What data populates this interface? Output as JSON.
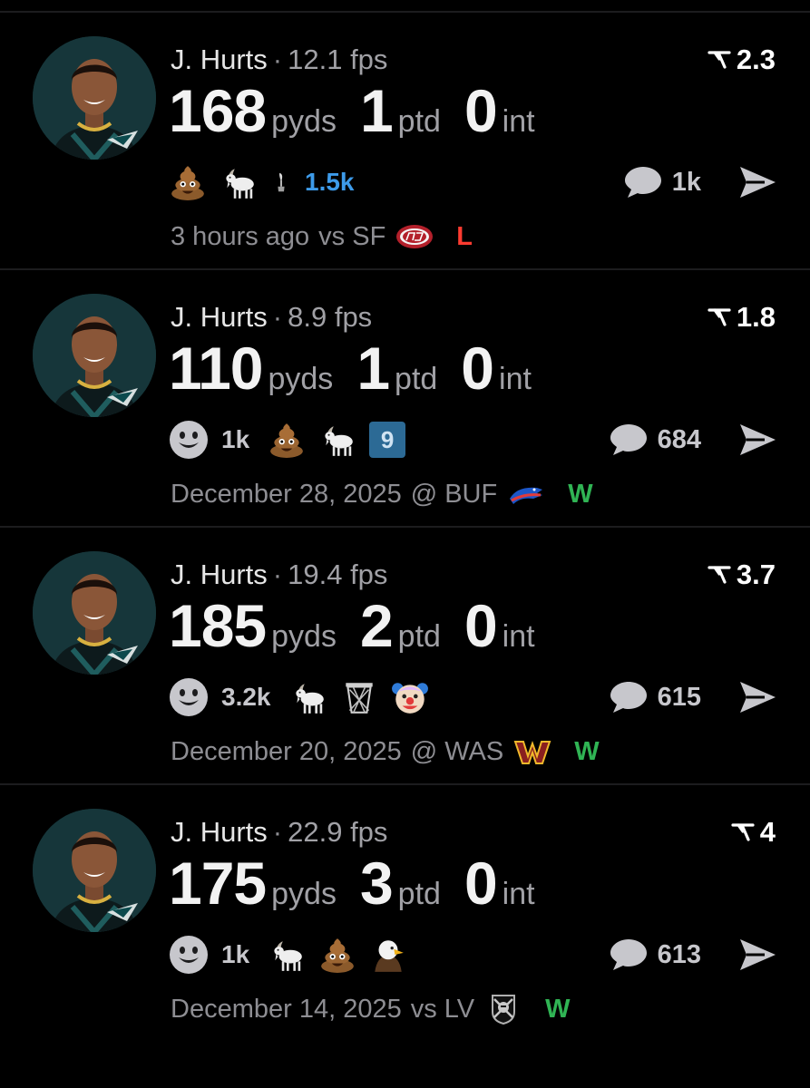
{
  "colors": {
    "background": "#000000",
    "win": "#30b454",
    "loss": "#ff3b30",
    "highlight_count": "#3d9bea"
  },
  "posts": [
    {
      "player": "J. Hurts",
      "separator": "·",
      "fps": "12.1 fps",
      "score": "2.3",
      "stats": [
        {
          "value": "168",
          "unit": "pyds"
        },
        {
          "value": "1",
          "unit": "ptd"
        },
        {
          "value": "0",
          "unit": "int"
        }
      ],
      "reactions": {
        "leading_icon": "poop-emoji",
        "icons": [
          "goat-emoji",
          "trophy-emoji"
        ],
        "count": "1.5k"
      },
      "comments": "1k",
      "time": "3 hours ago",
      "matchup": "vs SF",
      "opponent_logo": "49ers-logo",
      "result": "L"
    },
    {
      "player": "J. Hurts",
      "separator": "·",
      "fps": "8.9 fps",
      "score": "1.8",
      "stats": [
        {
          "value": "110",
          "unit": "pyds"
        },
        {
          "value": "1",
          "unit": "ptd"
        },
        {
          "value": "0",
          "unit": "int"
        }
      ],
      "reactions": {
        "leading_icon": "smiley-icon",
        "count": "1k",
        "icons": [
          "poop-emoji",
          "goat-emoji",
          "number-9-badge"
        ],
        "badge": "9"
      },
      "comments": "684",
      "time": "December 28, 2025",
      "matchup": "@ BUF",
      "opponent_logo": "bills-logo",
      "result": "W"
    },
    {
      "player": "J. Hurts",
      "separator": "·",
      "fps": "19.4 fps",
      "score": "3.7",
      "stats": [
        {
          "value": "185",
          "unit": "pyds"
        },
        {
          "value": "2",
          "unit": "ptd"
        },
        {
          "value": "0",
          "unit": "int"
        }
      ],
      "reactions": {
        "leading_icon": "smiley-icon",
        "count": "3.2k",
        "icons": [
          "goat-emoji",
          "basketball-hoop-emoji",
          "clown-emoji"
        ]
      },
      "comments": "615",
      "time": "December 20, 2025",
      "matchup": "@ WAS",
      "opponent_logo": "commanders-logo",
      "result": "W"
    },
    {
      "player": "J. Hurts",
      "separator": "·",
      "fps": "22.9 fps",
      "score": "4",
      "stats": [
        {
          "value": "175",
          "unit": "pyds"
        },
        {
          "value": "3",
          "unit": "ptd"
        },
        {
          "value": "0",
          "unit": "int"
        }
      ],
      "reactions": {
        "leading_icon": "smiley-icon",
        "count": "1k",
        "icons": [
          "goat-emoji",
          "poop-emoji",
          "eagle-emoji"
        ]
      },
      "comments": "613",
      "time": "December 14, 2025",
      "matchup": "vs LV",
      "opponent_logo": "raiders-logo",
      "result": "W"
    }
  ]
}
